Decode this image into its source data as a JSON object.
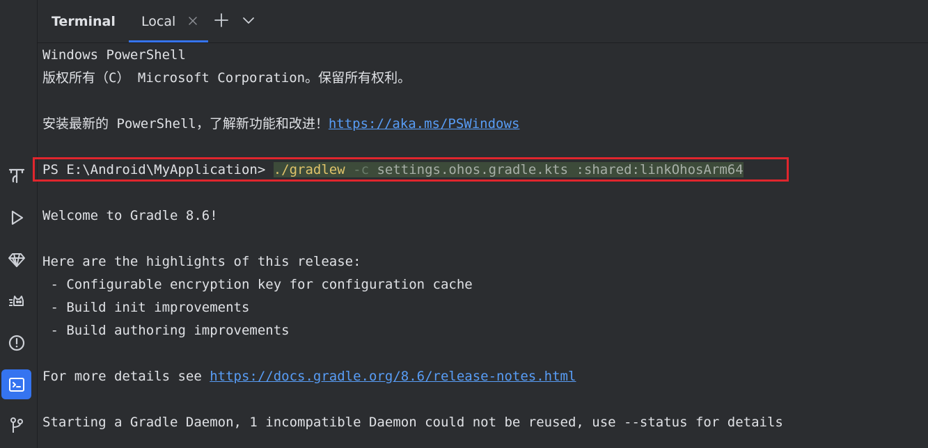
{
  "toolwindow": {
    "title": "Terminal",
    "tab_label": "Local"
  },
  "sidebar": {
    "items": [
      {
        "name": "text-tool-icon"
      },
      {
        "name": "run-icon"
      },
      {
        "name": "gem-icon"
      },
      {
        "name": "cat-icon"
      },
      {
        "name": "problems-icon"
      },
      {
        "name": "terminal-icon",
        "active": true
      },
      {
        "name": "git-icon"
      }
    ]
  },
  "terminal": {
    "lines": {
      "l1": "Windows PowerShell",
      "l2": "版权所有（C） Microsoft Corporation。保留所有权利。",
      "l3_text": "安装最新的 PowerShell，了解新功能和改进！",
      "l3_link": "https://aka.ms/PSWindows",
      "prompt": "PS E:\\Android\\MyApplication> ",
      "cmd_exe": "./gradlew",
      "cmd_flag": "-c",
      "cmd_args": "settings.ohos.gradle.kts :shared:linkOhosArm64",
      "welcome": "Welcome to Gradle 8.6!",
      "highlights_header": "Here are the highlights of this release:",
      "highlight_1": " - Configurable encryption key for configuration cache",
      "highlight_2": " - Build init improvements",
      "highlight_3": " - Build authoring improvements",
      "details_text": "For more details see ",
      "details_link": "https://docs.gradle.org/8.6/release-notes.html",
      "daemon": "Starting a Gradle Daemon, 1 incompatible Daemon could not be reused, use --status for details"
    }
  },
  "colors": {
    "background": "#2b2d30",
    "accent": "#3574f0",
    "link": "#589df6",
    "highlight_box": "#e0262d"
  }
}
